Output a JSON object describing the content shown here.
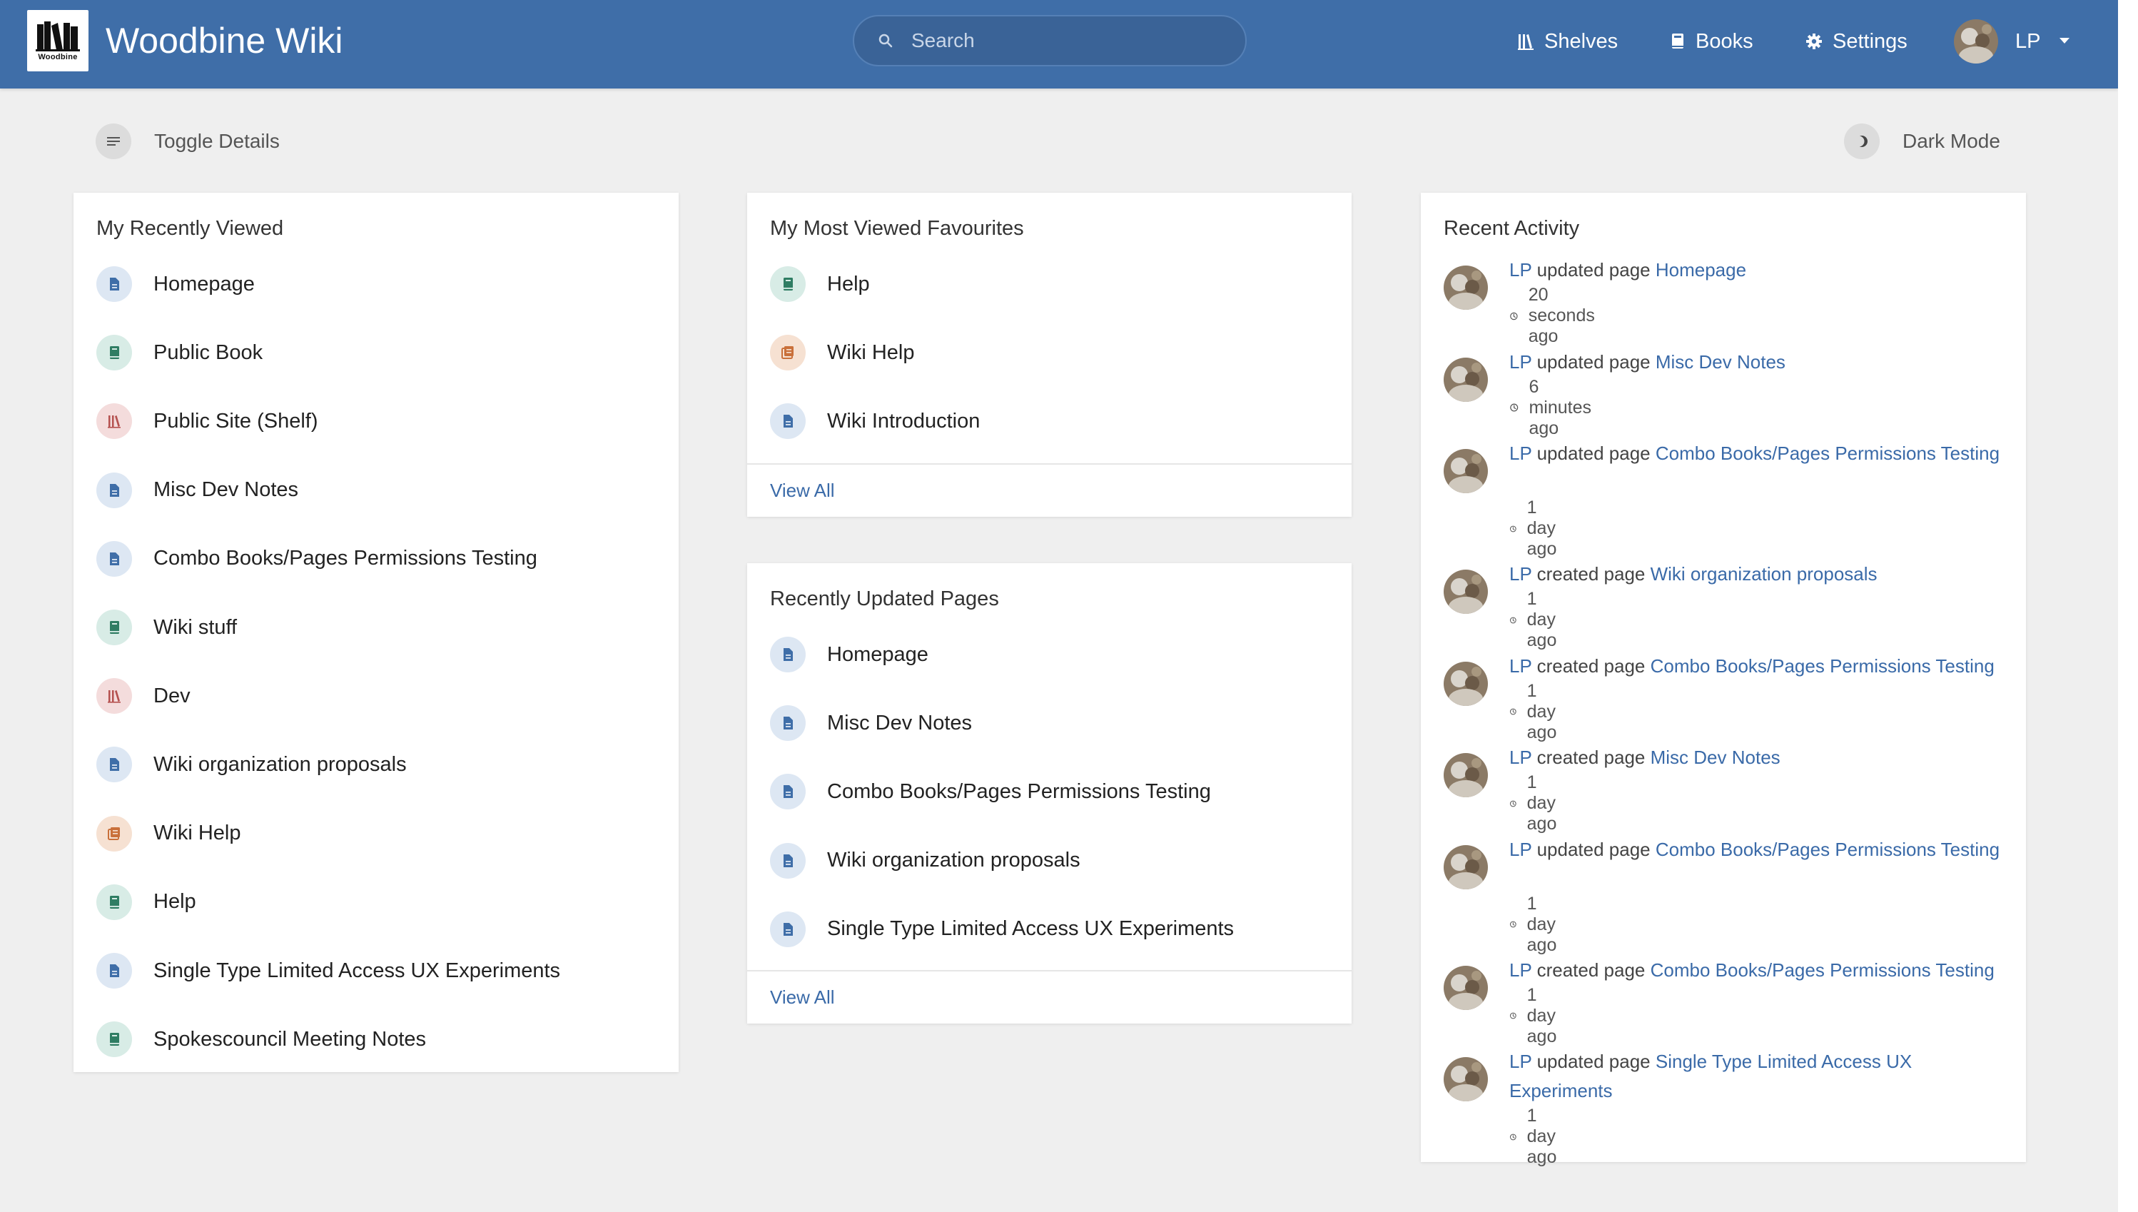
{
  "header": {
    "logo_text": "Woodbine",
    "app_title": "Woodbine Wiki",
    "search_placeholder": "Search",
    "nav": [
      {
        "label": "Shelves",
        "icon": "shelves-icon"
      },
      {
        "label": "Books",
        "icon": "book-icon"
      },
      {
        "label": "Settings",
        "icon": "gear-icon"
      }
    ],
    "user_initials": "LP"
  },
  "toolbar": {
    "toggle_details": "Toggle Details",
    "dark_mode": "Dark Mode"
  },
  "recently_viewed": {
    "title": "My Recently Viewed",
    "items": [
      {
        "label": "Homepage",
        "type": "page"
      },
      {
        "label": "Public Book",
        "type": "book"
      },
      {
        "label": "Public Site (Shelf)",
        "type": "shelf"
      },
      {
        "label": "Misc Dev Notes",
        "type": "page"
      },
      {
        "label": "Combo Books/Pages Permissions Testing",
        "type": "page"
      },
      {
        "label": "Wiki stuff",
        "type": "book"
      },
      {
        "label": "Dev",
        "type": "shelf"
      },
      {
        "label": "Wiki organization proposals",
        "type": "page"
      },
      {
        "label": "Wiki Help",
        "type": "chapter"
      },
      {
        "label": "Help",
        "type": "book"
      },
      {
        "label": "Single Type Limited Access UX Experiments",
        "type": "page"
      },
      {
        "label": "Spokescouncil Meeting Notes",
        "type": "book"
      }
    ]
  },
  "favourites": {
    "title": "My Most Viewed Favourites",
    "items": [
      {
        "label": "Help",
        "type": "book"
      },
      {
        "label": "Wiki Help",
        "type": "chapter"
      },
      {
        "label": "Wiki Introduction",
        "type": "page"
      }
    ],
    "view_all": "View All"
  },
  "recently_updated": {
    "title": "Recently Updated Pages",
    "items": [
      {
        "label": "Homepage",
        "type": "page"
      },
      {
        "label": "Misc Dev Notes",
        "type": "page"
      },
      {
        "label": "Combo Books/Pages Permissions Testing",
        "type": "page"
      },
      {
        "label": "Wiki organization proposals",
        "type": "page"
      },
      {
        "label": "Single Type Limited Access UX Experiments",
        "type": "page"
      }
    ],
    "view_all": "View All"
  },
  "recent_activity": {
    "title": "Recent Activity",
    "items": [
      {
        "user": "LP",
        "action": "updated page",
        "target": "Homepage",
        "time": "20 seconds ago"
      },
      {
        "user": "LP",
        "action": "updated page",
        "target": "Misc Dev Notes",
        "time": "6 minutes ago"
      },
      {
        "user": "LP",
        "action": "updated page",
        "target": "Combo Books/Pages Permissions Testing",
        "time": "1 day ago"
      },
      {
        "user": "LP",
        "action": "created page",
        "target": "Wiki organization proposals",
        "time": "1 day ago"
      },
      {
        "user": "LP",
        "action": "created page",
        "target": "Combo Books/Pages Permissions Testing",
        "time": "1 day ago"
      },
      {
        "user": "LP",
        "action": "created page",
        "target": "Misc Dev Notes",
        "time": "1 day ago"
      },
      {
        "user": "LP",
        "action": "updated page",
        "target": "Combo Books/Pages Permissions Testing",
        "time": "1 day ago"
      },
      {
        "user": "LP",
        "action": "created page",
        "target": "Combo Books/Pages Permissions Testing",
        "time": "1 day ago"
      },
      {
        "user": "LP",
        "action": "updated page",
        "target": "Single Type Limited Access UX Experiments",
        "time": "1 day ago"
      }
    ]
  },
  "colors": {
    "header": "#3f6ea8",
    "link": "#3a6aa8",
    "page_icon": "#3f6ea8",
    "book_icon": "#2f7d63",
    "shelf_icon": "#b5514f",
    "chapter_icon": "#c9703a"
  }
}
